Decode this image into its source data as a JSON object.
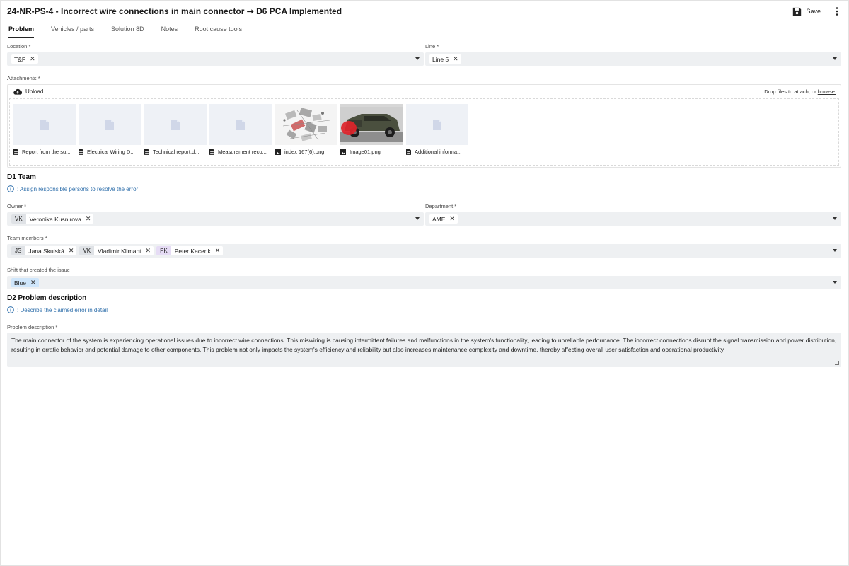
{
  "header": {
    "title": "24-NR-PS-4 - Incorrect wire connections in main connector ➞ D6 PCA Implemented",
    "save_label": "Save"
  },
  "tabs": [
    {
      "label": "Problem",
      "active": true
    },
    {
      "label": "Vehicles / parts",
      "active": false
    },
    {
      "label": "Solution 8D",
      "active": false
    },
    {
      "label": "Notes",
      "active": false
    },
    {
      "label": "Root cause tools",
      "active": false
    }
  ],
  "location": {
    "label": "Location *",
    "chips": [
      "T&F"
    ]
  },
  "line": {
    "label": "Line *",
    "chips": [
      "Line 5"
    ]
  },
  "attachments": {
    "label": "Attachments *",
    "upload_label": "Upload",
    "drop_text": "Drop files to attach, or",
    "browse_label": "browse.",
    "files": [
      {
        "name": "Report from the su...",
        "icon": "document-icon"
      },
      {
        "name": "Electrical Wiring D...",
        "icon": "document-icon"
      },
      {
        "name": "Technical report.d...",
        "icon": "document-icon"
      },
      {
        "name": "Measurement reco...",
        "icon": "document-icon"
      },
      {
        "name": "index 167(6).png",
        "icon": "image-icon"
      },
      {
        "name": "Image01.png",
        "icon": "image-icon"
      },
      {
        "name": "Additional informa...",
        "icon": "document-icon"
      }
    ]
  },
  "d1": {
    "title": "D1 Team",
    "hint": ": Assign responsible persons to resolve the error"
  },
  "owner": {
    "label": "Owner *",
    "initials": "VK",
    "name": "Veronika Kusnirova"
  },
  "department": {
    "label": "Department *",
    "chips": [
      "AME"
    ]
  },
  "team": {
    "label": "Team members *",
    "members": [
      {
        "initials": "JS",
        "name": "Jana Skulská"
      },
      {
        "initials": "VK",
        "name": "Vladimir Klimant"
      },
      {
        "initials": "PK",
        "name": "Peter Kacerik"
      }
    ]
  },
  "shift": {
    "label": "Shift that created the issue",
    "chips": [
      "Blue"
    ]
  },
  "d2": {
    "title": "D2 Problem description",
    "hint": ": Describe the claimed error in detail"
  },
  "problem": {
    "label": "Problem description *",
    "text": "The main connector of the system is experiencing operational issues due to incorrect wire connections. This miswiring is causing intermittent failures and malfunctions in the system's functionality, leading to unreliable performance. The incorrect connections disrupt the signal transmission and power distribution, resulting in erratic behavior and potential damage to other components. This problem not only impacts the system's efficiency and reliability but also increases maintenance complexity and downtime, thereby affecting overall user satisfaction and operational productivity."
  },
  "colors": {
    "accent": "#2f6fab",
    "field_bg": "#eef0f2",
    "chip_blue": "#cfe6fb",
    "avatar_purple": "#e6dcf5",
    "avatar_gray": "#dfe2e6"
  }
}
